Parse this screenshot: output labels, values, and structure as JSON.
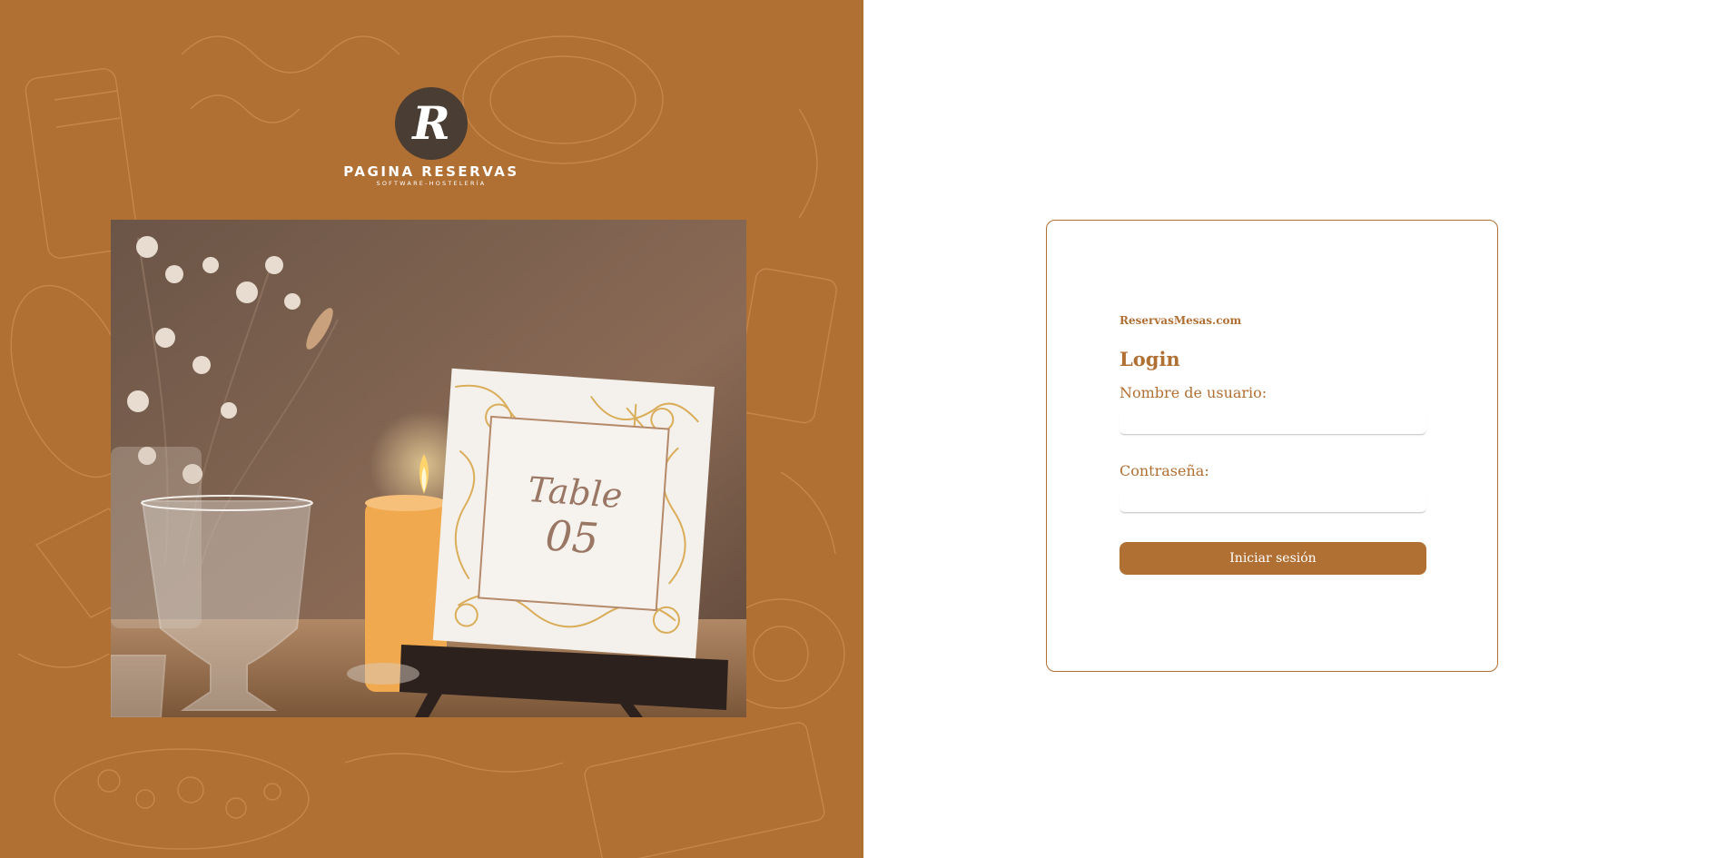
{
  "brand_panel": {
    "logo_letter": "R",
    "logo_name": "PAGINA RESERVAS",
    "logo_tagline": "SOFTWARE-HOSTELERÍA",
    "photo_card_word": "Table",
    "photo_card_number": "05"
  },
  "login": {
    "brand": "ReservasMesas.com",
    "title": "Login",
    "username_label": "Nombre de usuario:",
    "username_value": "",
    "password_label": "Contraseña:",
    "password_value": "",
    "submit_label": "Iniciar sesión"
  },
  "colors": {
    "accent": "#b06f33",
    "logo_dark": "#4a3d33"
  }
}
